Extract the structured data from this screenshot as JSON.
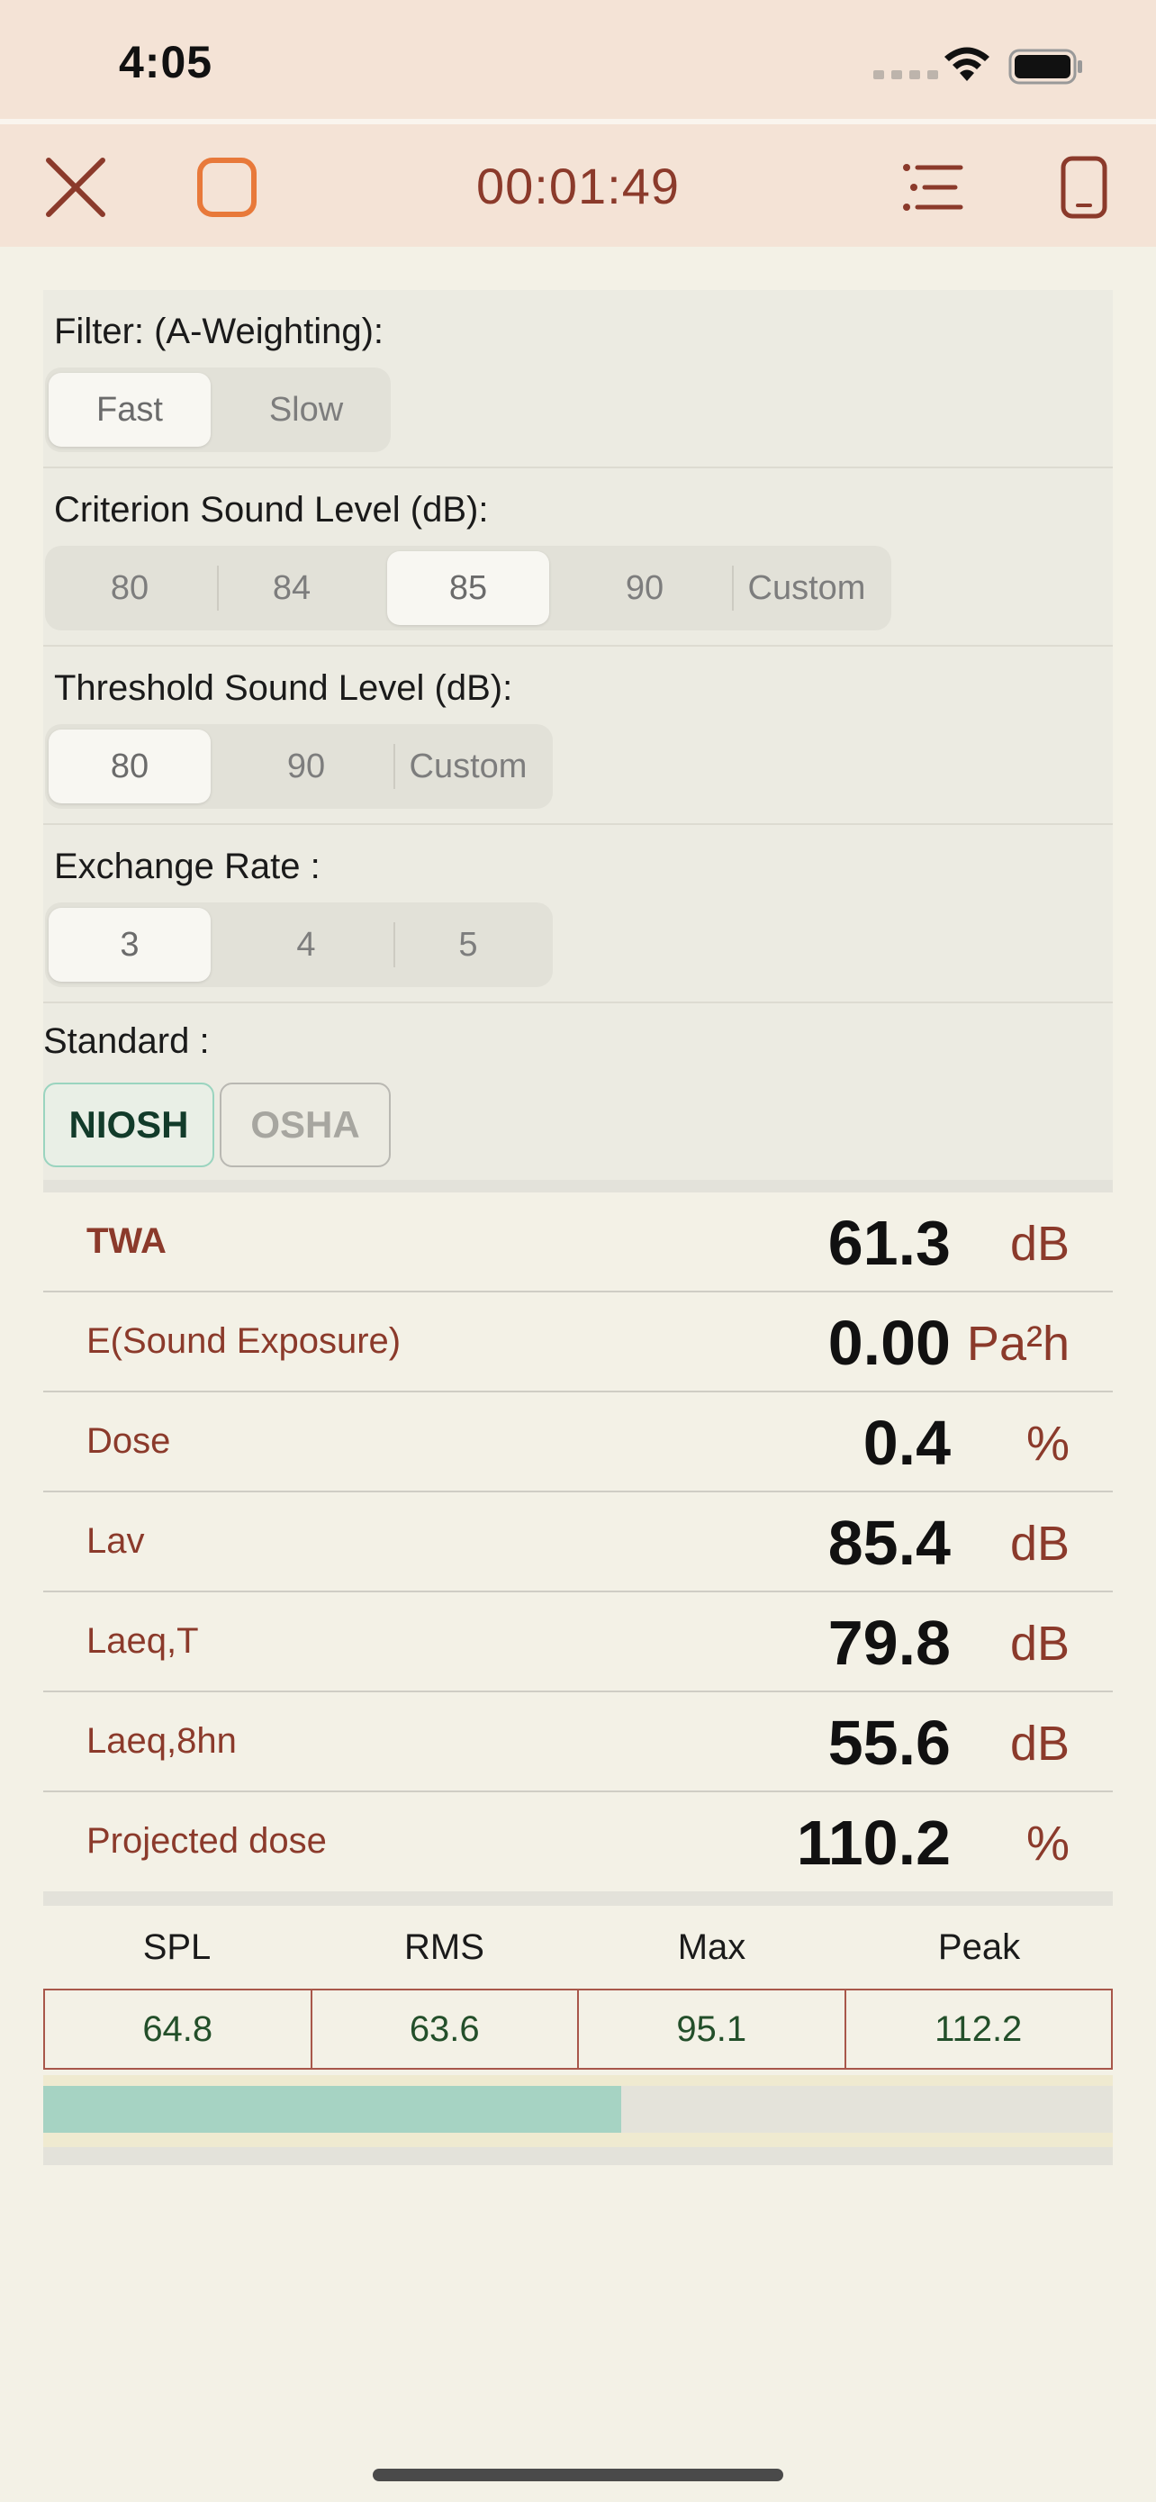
{
  "status_bar": {
    "time": "4:05"
  },
  "toolbar": {
    "timer": "00:01:49"
  },
  "settings": {
    "filter": {
      "label": "Filter: (A-Weighting):",
      "options": [
        "Fast",
        "Slow"
      ],
      "selected": "Fast"
    },
    "criterion": {
      "label": "Criterion Sound Level (dB):",
      "options": [
        "80",
        "84",
        "85",
        "90",
        "Custom"
      ],
      "selected": "85"
    },
    "threshold": {
      "label": "Threshold Sound Level (dB):",
      "options": [
        "80",
        "90",
        "Custom"
      ],
      "selected": "80"
    },
    "exchange": {
      "label": "Exchange Rate :",
      "options": [
        "3",
        "4",
        "5"
      ],
      "selected": "3"
    },
    "standard": {
      "label": "Standard :",
      "options": [
        "NIOSH",
        "OSHA"
      ],
      "selected": "NIOSH"
    }
  },
  "metrics": [
    {
      "label": "TWA",
      "value": "61.3",
      "unit": "dB"
    },
    {
      "label": "E(Sound Exposure)",
      "value": "0.00",
      "unit": "Pa²h"
    },
    {
      "label": "Dose",
      "value": "0.4",
      "unit": "%"
    },
    {
      "label": "Lav",
      "value": "85.4",
      "unit": "dB"
    },
    {
      "label": "Laeq,T",
      "value": "79.8",
      "unit": "dB"
    },
    {
      "label": "Laeq,8hn",
      "value": "55.6",
      "unit": "dB"
    },
    {
      "label": "Projected dose",
      "value": "110.2",
      "unit": "%"
    }
  ],
  "readings": {
    "headers": [
      "SPL",
      "RMS",
      "Max",
      "Peak"
    ],
    "values": [
      "64.8",
      "63.6",
      "95.1",
      "112.2"
    ]
  },
  "level_meter": {
    "fraction": 0.54
  },
  "colors": {
    "accent": "#8b3a2b",
    "stop": "#e8793a",
    "niosh_border": "#9ad4bf",
    "meter_fill": "#a6d3c3"
  }
}
